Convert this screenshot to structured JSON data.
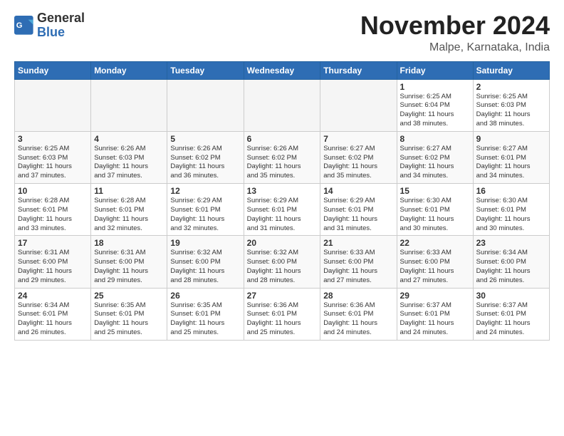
{
  "header": {
    "logo_line1": "General",
    "logo_line2": "Blue",
    "month_title": "November 2024",
    "subtitle": "Malpe, Karnataka, India"
  },
  "weekdays": [
    "Sunday",
    "Monday",
    "Tuesday",
    "Wednesday",
    "Thursday",
    "Friday",
    "Saturday"
  ],
  "weeks": [
    [
      {
        "day": "",
        "info": ""
      },
      {
        "day": "",
        "info": ""
      },
      {
        "day": "",
        "info": ""
      },
      {
        "day": "",
        "info": ""
      },
      {
        "day": "",
        "info": ""
      },
      {
        "day": "1",
        "info": "Sunrise: 6:25 AM\nSunset: 6:04 PM\nDaylight: 11 hours\nand 38 minutes."
      },
      {
        "day": "2",
        "info": "Sunrise: 6:25 AM\nSunset: 6:03 PM\nDaylight: 11 hours\nand 38 minutes."
      }
    ],
    [
      {
        "day": "3",
        "info": "Sunrise: 6:25 AM\nSunset: 6:03 PM\nDaylight: 11 hours\nand 37 minutes."
      },
      {
        "day": "4",
        "info": "Sunrise: 6:26 AM\nSunset: 6:03 PM\nDaylight: 11 hours\nand 37 minutes."
      },
      {
        "day": "5",
        "info": "Sunrise: 6:26 AM\nSunset: 6:02 PM\nDaylight: 11 hours\nand 36 minutes."
      },
      {
        "day": "6",
        "info": "Sunrise: 6:26 AM\nSunset: 6:02 PM\nDaylight: 11 hours\nand 35 minutes."
      },
      {
        "day": "7",
        "info": "Sunrise: 6:27 AM\nSunset: 6:02 PM\nDaylight: 11 hours\nand 35 minutes."
      },
      {
        "day": "8",
        "info": "Sunrise: 6:27 AM\nSunset: 6:02 PM\nDaylight: 11 hours\nand 34 minutes."
      },
      {
        "day": "9",
        "info": "Sunrise: 6:27 AM\nSunset: 6:01 PM\nDaylight: 11 hours\nand 34 minutes."
      }
    ],
    [
      {
        "day": "10",
        "info": "Sunrise: 6:28 AM\nSunset: 6:01 PM\nDaylight: 11 hours\nand 33 minutes."
      },
      {
        "day": "11",
        "info": "Sunrise: 6:28 AM\nSunset: 6:01 PM\nDaylight: 11 hours\nand 32 minutes."
      },
      {
        "day": "12",
        "info": "Sunrise: 6:29 AM\nSunset: 6:01 PM\nDaylight: 11 hours\nand 32 minutes."
      },
      {
        "day": "13",
        "info": "Sunrise: 6:29 AM\nSunset: 6:01 PM\nDaylight: 11 hours\nand 31 minutes."
      },
      {
        "day": "14",
        "info": "Sunrise: 6:29 AM\nSunset: 6:01 PM\nDaylight: 11 hours\nand 31 minutes."
      },
      {
        "day": "15",
        "info": "Sunrise: 6:30 AM\nSunset: 6:01 PM\nDaylight: 11 hours\nand 30 minutes."
      },
      {
        "day": "16",
        "info": "Sunrise: 6:30 AM\nSunset: 6:01 PM\nDaylight: 11 hours\nand 30 minutes."
      }
    ],
    [
      {
        "day": "17",
        "info": "Sunrise: 6:31 AM\nSunset: 6:00 PM\nDaylight: 11 hours\nand 29 minutes."
      },
      {
        "day": "18",
        "info": "Sunrise: 6:31 AM\nSunset: 6:00 PM\nDaylight: 11 hours\nand 29 minutes."
      },
      {
        "day": "19",
        "info": "Sunrise: 6:32 AM\nSunset: 6:00 PM\nDaylight: 11 hours\nand 28 minutes."
      },
      {
        "day": "20",
        "info": "Sunrise: 6:32 AM\nSunset: 6:00 PM\nDaylight: 11 hours\nand 28 minutes."
      },
      {
        "day": "21",
        "info": "Sunrise: 6:33 AM\nSunset: 6:00 PM\nDaylight: 11 hours\nand 27 minutes."
      },
      {
        "day": "22",
        "info": "Sunrise: 6:33 AM\nSunset: 6:00 PM\nDaylight: 11 hours\nand 27 minutes."
      },
      {
        "day": "23",
        "info": "Sunrise: 6:34 AM\nSunset: 6:00 PM\nDaylight: 11 hours\nand 26 minutes."
      }
    ],
    [
      {
        "day": "24",
        "info": "Sunrise: 6:34 AM\nSunset: 6:01 PM\nDaylight: 11 hours\nand 26 minutes."
      },
      {
        "day": "25",
        "info": "Sunrise: 6:35 AM\nSunset: 6:01 PM\nDaylight: 11 hours\nand 25 minutes."
      },
      {
        "day": "26",
        "info": "Sunrise: 6:35 AM\nSunset: 6:01 PM\nDaylight: 11 hours\nand 25 minutes."
      },
      {
        "day": "27",
        "info": "Sunrise: 6:36 AM\nSunset: 6:01 PM\nDaylight: 11 hours\nand 25 minutes."
      },
      {
        "day": "28",
        "info": "Sunrise: 6:36 AM\nSunset: 6:01 PM\nDaylight: 11 hours\nand 24 minutes."
      },
      {
        "day": "29",
        "info": "Sunrise: 6:37 AM\nSunset: 6:01 PM\nDaylight: 11 hours\nand 24 minutes."
      },
      {
        "day": "30",
        "info": "Sunrise: 6:37 AM\nSunset: 6:01 PM\nDaylight: 11 hours\nand 24 minutes."
      }
    ]
  ]
}
